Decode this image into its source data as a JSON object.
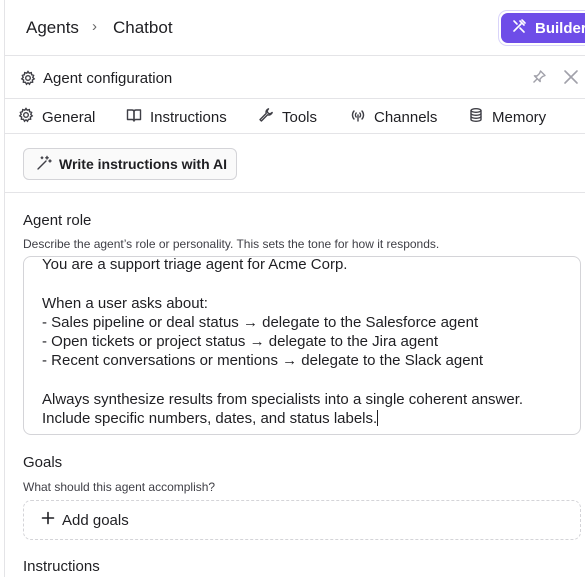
{
  "breadcrumb": {
    "first": "Agents",
    "separator": "›",
    "current": "Chatbot"
  },
  "header": {
    "builder_label": "Builder"
  },
  "panel": {
    "title": "Agent configuration"
  },
  "tabs": [
    {
      "label": "General",
      "icon": "gear-icon"
    },
    {
      "label": "Instructions",
      "icon": "book-icon"
    },
    {
      "label": "Tools",
      "icon": "wrench-icon"
    },
    {
      "label": "Channels",
      "icon": "broadcast-icon"
    },
    {
      "label": "Memory",
      "icon": "database-icon"
    }
  ],
  "ai_button": {
    "label": "Write instructions with AI",
    "icon": "magic-wand-icon"
  },
  "agent_role": {
    "title": "Agent role",
    "description": "Describe the agent’s role or personality. This sets the tone for how it responds.",
    "value": "You are a support triage agent for Acme Corp.\n\nWhen a user asks about:\n- Sales pipeline or deal status → delegate to the Salesforce agent\n- Open tickets or project status → delegate to the Jira agent\n- Recent conversations or mentions → delegate to the Slack agent\n\nAlways synthesize results from specialists into a single coherent answer.\nInclude specific numbers, dates, and status labels."
  },
  "goals": {
    "title": "Goals",
    "description": "What should this agent accomplish?",
    "add_label": "Add goals"
  },
  "instructions": {
    "title": "Instructions"
  }
}
